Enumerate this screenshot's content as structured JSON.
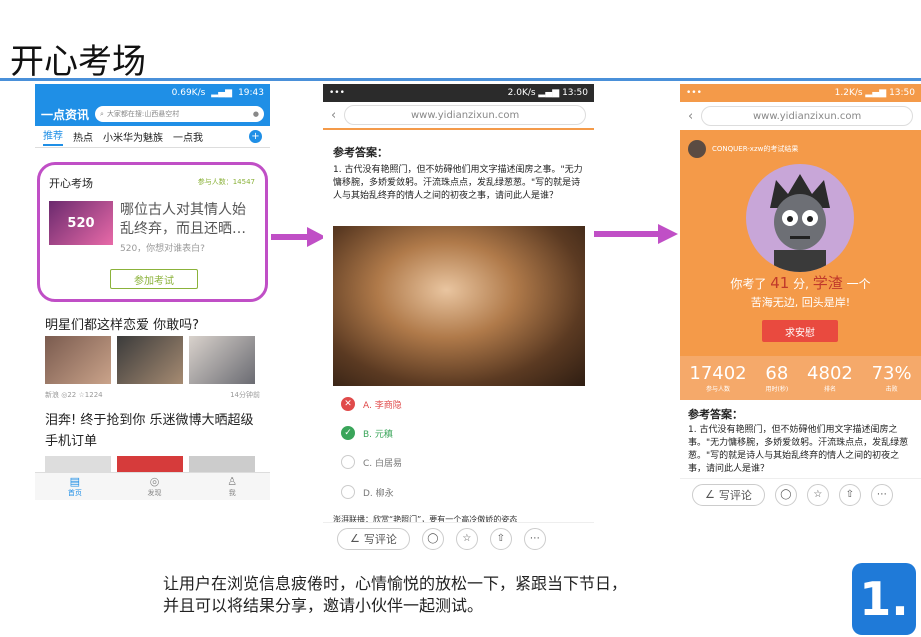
{
  "slide_title": "开心考场",
  "caption": [
    "让用户在浏览信息疲倦时，心情愉悦的放松一下，紧跟当下节日，",
    "并且可以将结果分享，邀请小伙伴一起测试。"
  ],
  "step_number": "1.",
  "phone1": {
    "status": {
      "speed": "0.69K/s",
      "battery": "53",
      "time": "19:43"
    },
    "logo": "一点资讯",
    "search_placeholder": "大家都在搜:山西悬空村",
    "tabs": [
      "推荐",
      "热点",
      "小米华为魅族",
      "一点我"
    ],
    "card": {
      "title": "开心考场",
      "count": "参与人数：14547",
      "question": "哪位古人对其情人始乱终弃，而且还晒…",
      "sub": "520，你想对谁表白?",
      "button": "参加考试",
      "img_text": "520"
    },
    "news1": {
      "title": "明星们都这样恋爱 你敢吗?",
      "source": "新浪",
      "comments": "22",
      "likes": "1224",
      "time": "14分钟前"
    },
    "news2": {
      "title": "泪奔! 终于抢到你 乐迷微博大晒超级手机订单"
    },
    "nav": [
      "首页",
      "发现",
      "我"
    ]
  },
  "phone2": {
    "status": {
      "dots": "•••",
      "speed": "2.0K/s",
      "battery": "58",
      "time": "13:50"
    },
    "url": "www.yidianzixun.com",
    "answer_heading": "参考答案：",
    "question": "1. 古代没有艳照门，但不妨碍他们用文字描述闺房之事。\"无力慵移腕，多娇爱敛躬。汗流珠点点，发乱绿葱葱。\"写的就是诗人与其始乱终弃的情人之间的初夜之事，请问此人是谁？",
    "options": [
      {
        "label": "A. 李商隐",
        "state": "wrong"
      },
      {
        "label": "B. 元稹",
        "state": "correct"
      },
      {
        "label": "C. 白居易",
        "state": "none"
      },
      {
        "label": "D. 柳永",
        "state": "none"
      }
    ],
    "footer_text": "澎湃联播：欣赏“艳照门”，要有一个高冷傲娇的姿态",
    "comment_button": "写评论"
  },
  "phone3": {
    "status": {
      "dots": "•••",
      "speed": "1.2K/s",
      "battery": "58",
      "time": "13:50"
    },
    "url": "www.yidianzixun.com",
    "user_line": "CONQUER-xzw的考试结果",
    "result_prefix": "你考了",
    "score": "41",
    "result_mid": "分,",
    "level": "学渣",
    "result_suffix": "一个",
    "result_line2": "苦海无边, 回头是岸!",
    "comfort_button": "求安慰",
    "stats": [
      {
        "value": "17402",
        "label": "参与人数"
      },
      {
        "value": "68",
        "label": "用时(秒)"
      },
      {
        "value": "4802",
        "label": "排名"
      },
      {
        "value": "73%",
        "label": "击败"
      }
    ],
    "answer_heading": "参考答案：",
    "question": "1. 古代没有艳照门，但不妨碍他们用文字描述闺房之事。\"无力慵移腕，多娇爱敛躬。汗流珠点点，发乱绿葱葱。\"写的就是诗人与其始乱终弃的情人之间的初夜之事，请问此人是谁？",
    "comment_button": "写评论"
  },
  "colors": {
    "accent_blue": "#1f8fe6",
    "orange": "#f49a49",
    "magenta": "#c04fc6",
    "green": "#8bb23a"
  }
}
